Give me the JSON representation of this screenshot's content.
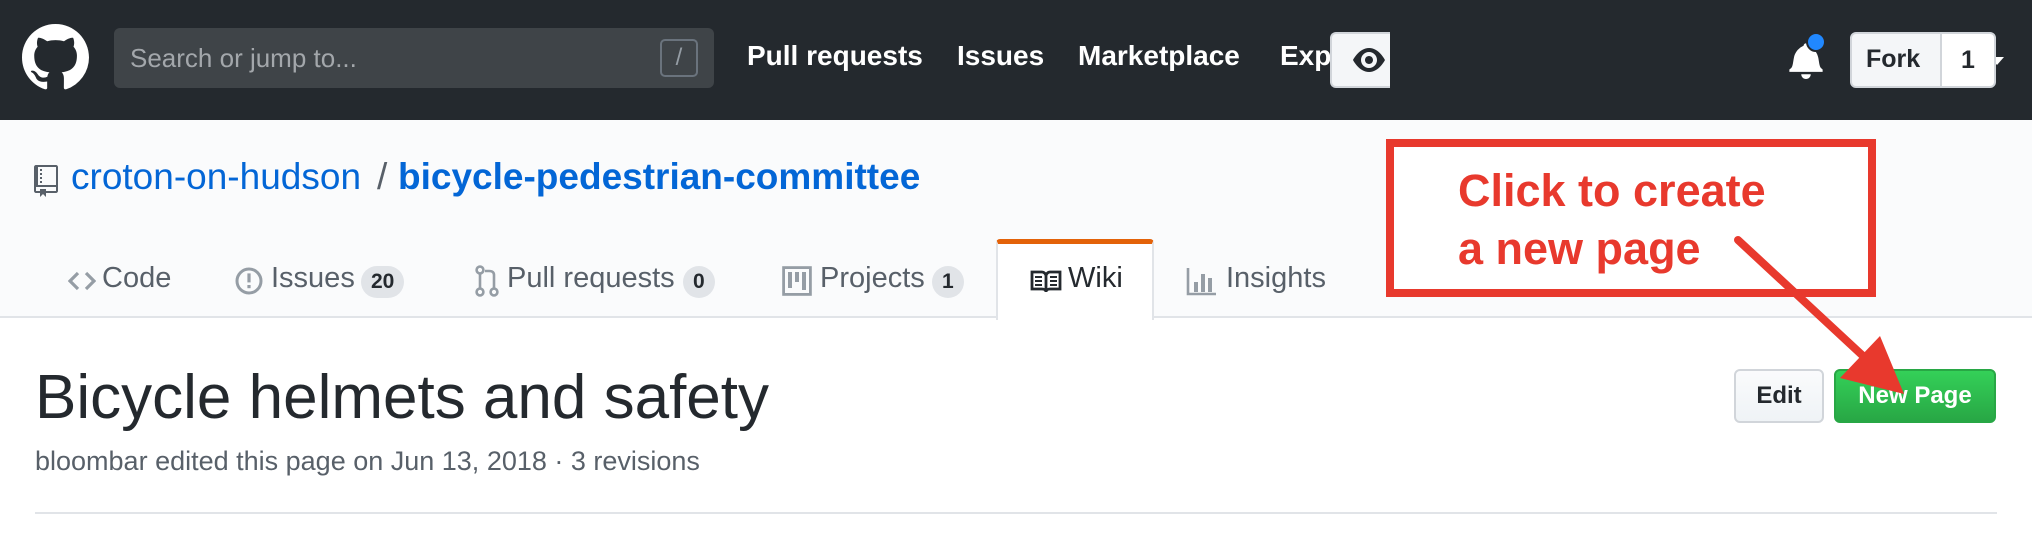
{
  "header": {
    "search": {
      "placeholder": "Search or jump to...",
      "hint": "/"
    },
    "nav": {
      "pull_requests": "Pull requests",
      "issues": "Issues",
      "marketplace": "Marketplace",
      "explore": "Explore"
    },
    "plus_label": "+",
    "icons": [
      "github-logo-icon",
      "bell-icon",
      "plus-icon",
      "avatar"
    ]
  },
  "repo": {
    "owner": "croton-on-hudson",
    "separator": "/",
    "name": "bicycle-pedestrian-committee",
    "fork_label": "Fork",
    "fork_count": "1"
  },
  "tabs": [
    {
      "label": "Code",
      "icon": "code-icon"
    },
    {
      "label": "Issues",
      "count": "20",
      "icon": "issue-icon"
    },
    {
      "label": "Pull requests",
      "count": "0",
      "icon": "pull-request-icon"
    },
    {
      "label": "Projects",
      "count": "1",
      "icon": "project-icon"
    },
    {
      "label": "Wiki",
      "icon": "book-icon",
      "selected": true
    },
    {
      "label": "Insights",
      "icon": "graph-icon"
    }
  ],
  "page": {
    "title": "Bicycle helmets and safety",
    "meta": "bloombar edited this page on Jun 13, 2018 · 3 revisions",
    "edit_label": "Edit",
    "new_page_label": "New Page"
  },
  "annotation": {
    "line1": "Click to create",
    "line2": "a new page",
    "color": "#e8392d"
  },
  "colors": {
    "navbar": "#24292e",
    "link": "#0366d6",
    "selected_tab": "#e36209",
    "primary_button": "#28a745"
  }
}
